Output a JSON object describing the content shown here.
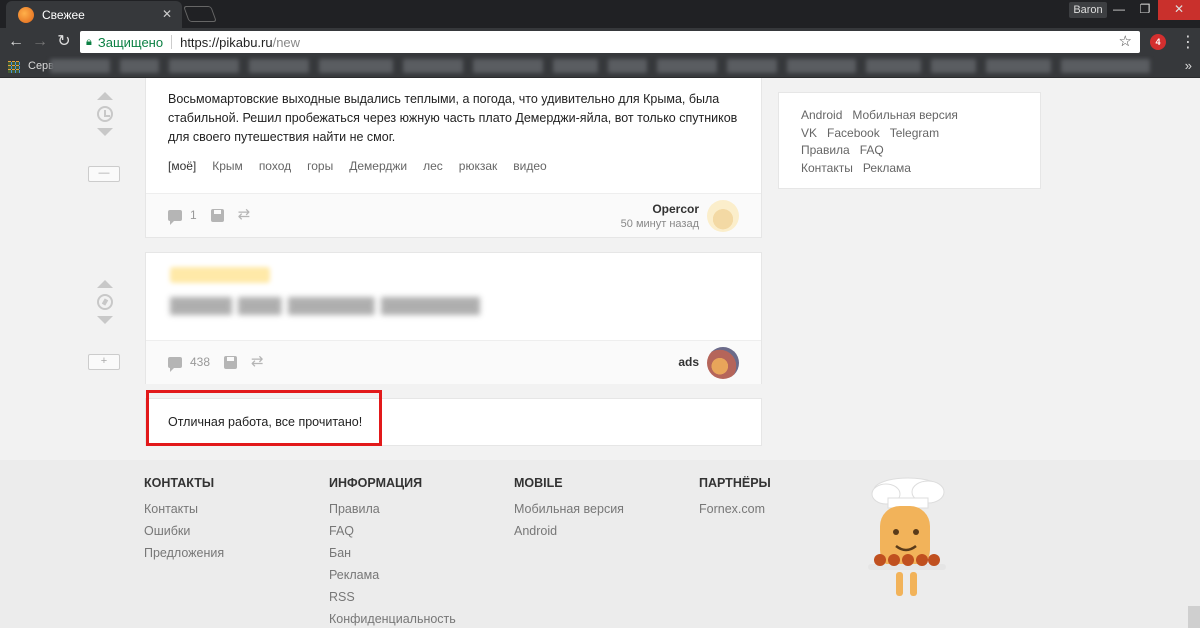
{
  "browser": {
    "tab_title": "Свежее",
    "profile": "Baron",
    "secure_label": "Защищено",
    "url_host": "https://pikabu.ru",
    "url_path": "/new",
    "bookmarks_label": "Серв",
    "extension_badge": "4"
  },
  "post1": {
    "text": "Восьмомартовские выходные выдались теплыми, а погода, что удивительно для Крыма, была стабильной. Решил пробежаться через южную часть плато Демерджи-яйла, вот только спутников для своего путешествия найти не смог.",
    "tags": [
      "[моё]",
      "Крым",
      "поход",
      "горы",
      "Демерджи",
      "лес",
      "рюкзак",
      "видео"
    ],
    "comments": "1",
    "author": "Opercor",
    "time": "50 минут назад",
    "toggle": "—"
  },
  "post2": {
    "comments": "438",
    "author": "ads",
    "toggle": "+"
  },
  "done_message": "Отличная работа, все прочитано!",
  "sidebar": {
    "rows": [
      [
        "Android",
        "Мобильная версия"
      ],
      [
        "VK",
        "Facebook",
        "Telegram"
      ],
      [
        "Правила",
        "FAQ"
      ],
      [
        "Контакты",
        "Реклама"
      ]
    ]
  },
  "footer": {
    "contacts": {
      "title": "КОНТАКТЫ",
      "links": [
        "Контакты",
        "Ошибки",
        "Предложения"
      ]
    },
    "info": {
      "title": "ИНФОРМАЦИЯ",
      "links": [
        "Правила",
        "FAQ",
        "Бан",
        "Реклама",
        "RSS",
        "Конфиденциальность"
      ]
    },
    "mobile": {
      "title": "MOBILE",
      "links": [
        "Мобильная версия",
        "Android"
      ]
    },
    "partners": {
      "title": "ПАРТНЁРЫ",
      "links": [
        "Fornex.com"
      ]
    }
  },
  "colors": {
    "highlight": "#e2191a",
    "secure": "#0b8043",
    "chrome_dark": "#202124"
  }
}
